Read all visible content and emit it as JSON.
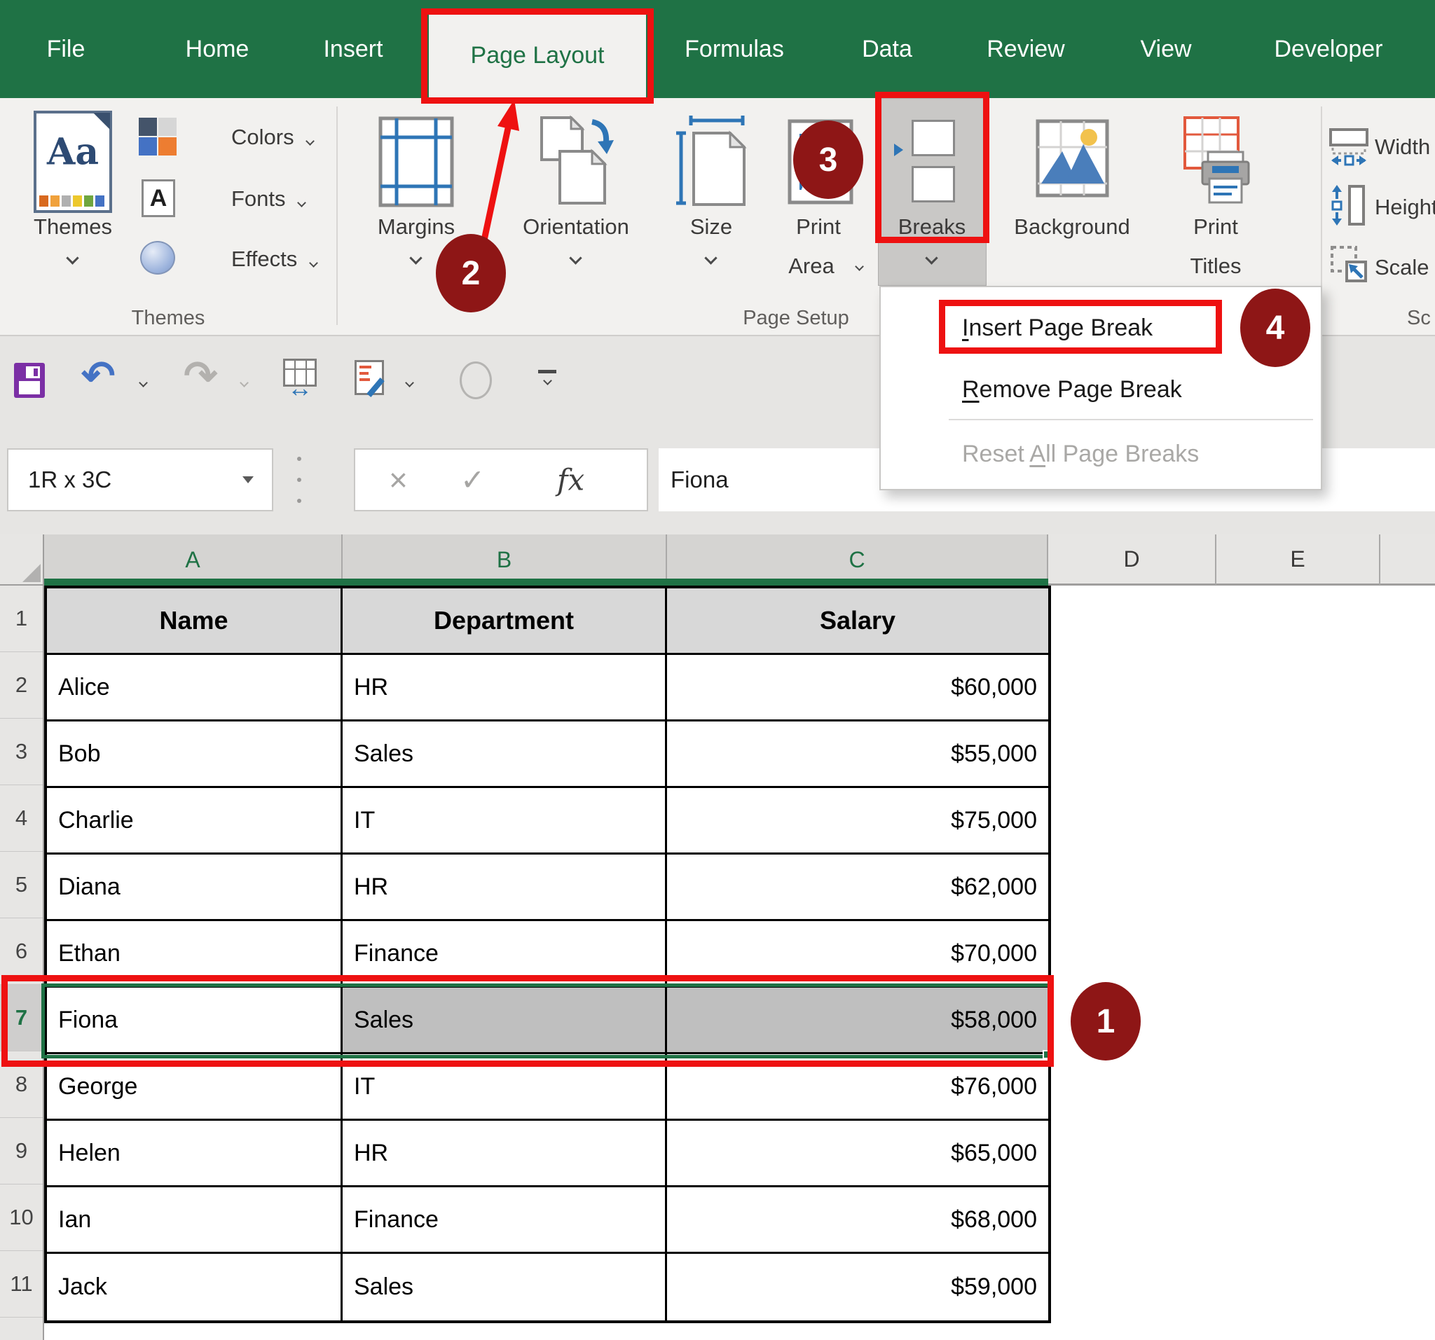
{
  "colors": {
    "excel_green": "#1F7245",
    "annotation_red": "#EE1111",
    "badge_maroon": "#8E1616"
  },
  "ribbon": {
    "tabs": [
      "File",
      "Home",
      "Insert",
      "Page Layout",
      "Formulas",
      "Data",
      "Review",
      "View",
      "Developer"
    ],
    "active_tab": "Page Layout",
    "themes_group": {
      "label": "Themes",
      "themes_button": "Themes",
      "themes_icon_text": "Aa",
      "colors_button": "Colors",
      "fonts_button": "Fonts",
      "fonts_icon_text": "A",
      "effects_button": "Effects"
    },
    "page_setup_group": {
      "label": "Page Setup",
      "margins": "Margins",
      "orientation": "Orientation",
      "size": "Size",
      "print_area_line1": "Print",
      "print_area_line2": "Area",
      "breaks": "Breaks",
      "background": "Background",
      "print_titles_line1": "Print",
      "print_titles_line2": "Titles"
    },
    "scale_group": {
      "label_partial": "Sc",
      "width": "Width",
      "height": "Height",
      "scale": "Scale"
    }
  },
  "breaks_menu": {
    "items": [
      {
        "accel": "I",
        "post": "nsert Page Break",
        "pre": ""
      },
      {
        "accel": "R",
        "post": "emove Page Break",
        "pre": ""
      },
      {
        "accel": "A",
        "post": "ll Page Breaks",
        "pre": "Reset ",
        "disabled": true
      }
    ]
  },
  "formula_bar": {
    "name_box_value": "1R x 3C",
    "cancel_glyph": "×",
    "enter_glyph": "✓",
    "fx_glyph": "fx",
    "formula_value": "Fiona"
  },
  "quick_access": {
    "icons": [
      "save",
      "undo",
      "redo",
      "fit-column-width",
      "edit-form",
      "placeholder-circle",
      "customize-toolbar"
    ],
    "undo_glyph": "↶",
    "redo_glyph": "↷",
    "fit_arrow_glyph": "↔"
  },
  "annotations": {
    "step1": "1",
    "step2": "2",
    "step3": "3",
    "step4": "4"
  },
  "sheet": {
    "column_headers": [
      "A",
      "B",
      "C",
      "D",
      "E"
    ],
    "selected_columns": "A:C",
    "selected_row": "7",
    "rows": [
      {
        "num": "1",
        "name": "Name",
        "dept": "Department",
        "salary": "Salary"
      },
      {
        "num": "2",
        "name": "Alice",
        "dept": "HR",
        "salary": "$60,000"
      },
      {
        "num": "3",
        "name": "Bob",
        "dept": "Sales",
        "salary": "$55,000"
      },
      {
        "num": "4",
        "name": "Charlie",
        "dept": "IT",
        "salary": "$75,000"
      },
      {
        "num": "5",
        "name": "Diana",
        "dept": "HR",
        "salary": "$62,000"
      },
      {
        "num": "6",
        "name": "Ethan",
        "dept": "Finance",
        "salary": "$70,000"
      },
      {
        "num": "7",
        "name": "Fiona",
        "dept": "Sales",
        "salary": "$58,000"
      },
      {
        "num": "8",
        "name": "George",
        "dept": "IT",
        "salary": "$76,000"
      },
      {
        "num": "9",
        "name": "Helen",
        "dept": "HR",
        "salary": "$65,000"
      },
      {
        "num": "10",
        "name": "Ian",
        "dept": "Finance",
        "salary": "$68,000"
      },
      {
        "num": "11",
        "name": "Jack",
        "dept": "Sales",
        "salary": "$59,000"
      }
    ]
  }
}
